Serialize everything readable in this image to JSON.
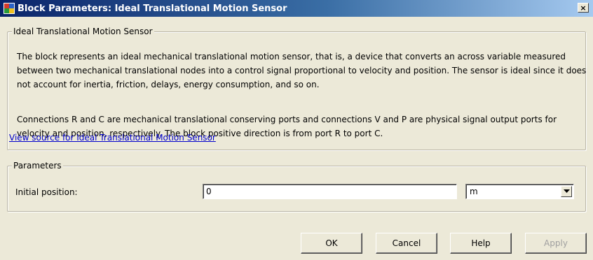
{
  "window": {
    "title": "Block Parameters: Ideal Translational Motion Sensor",
    "app_icon": "simulink-block-icon",
    "close_label": "×"
  },
  "description_group": {
    "legend": "Ideal Translational Motion Sensor",
    "paragraph1": "The block represents an ideal mechanical translational motion sensor, that is, a device that converts an across variable measured between two mechanical translational nodes into a control signal proportional to velocity and position. The sensor is ideal since it does not account for inertia, friction, delays, energy consumption, and so on.",
    "paragraph2": "Connections R and C are mechanical translational conserving ports and connections V and P are physical signal output ports for velocity and position, respectively. The block positive direction is from port R to port C.",
    "link": "View source for Ideal Translational Motion Sensor"
  },
  "parameters_group": {
    "legend": "Parameters",
    "initial_position": {
      "label": "Initial position:",
      "value": "0",
      "unit": "m"
    }
  },
  "buttons": {
    "ok": "OK",
    "cancel": "Cancel",
    "help": "Help",
    "apply": "Apply"
  }
}
